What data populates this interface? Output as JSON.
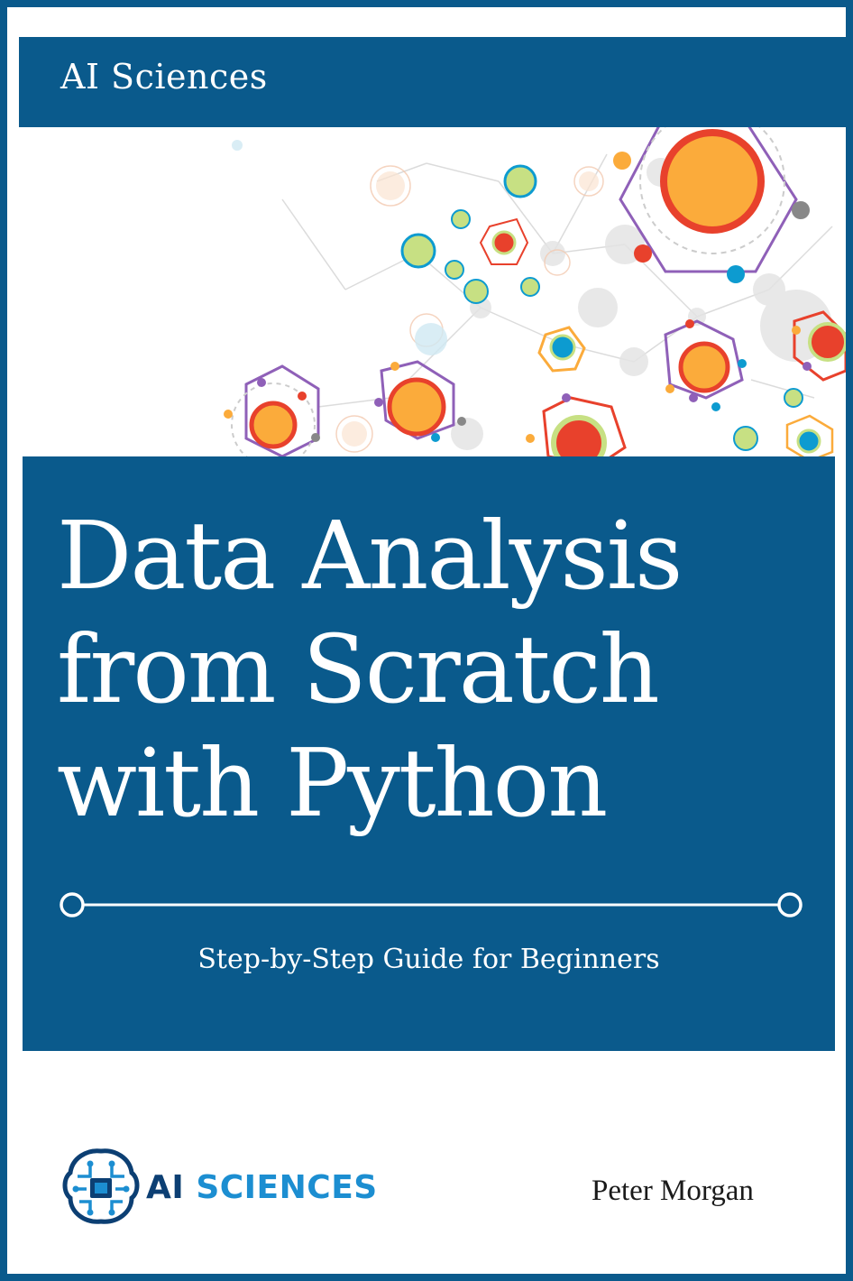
{
  "cover": {
    "publisher_banner": "AI Sciences",
    "title_lines": [
      "Data Analysis",
      "from Scratch",
      "with Python"
    ],
    "subtitle": "Step-by-Step Guide for Beginners",
    "logo": {
      "icon": "brain-circuit-icon",
      "text_ai": "AI",
      "text_rest": "SCIENCES"
    },
    "author": "Peter Morgan"
  },
  "colors": {
    "brand_blue": "#0a5a8c",
    "logo_light_blue": "#1c8ed1",
    "logo_dark_blue": "#0c3f73",
    "node_orange": "#fbab3b",
    "node_red": "#e8412c",
    "node_green": "#c7e083",
    "node_teal": "#0d9bd0",
    "edge_purple": "#8f60b8"
  }
}
